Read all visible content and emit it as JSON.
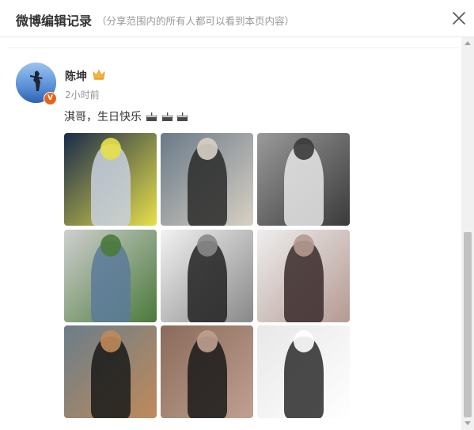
{
  "dialog": {
    "title": "微博编辑记录",
    "subtitle": "（分享范围内的所有人都可以看到本页内容）",
    "close_icon": "close-icon"
  },
  "post": {
    "username": "陈坤",
    "badge_icon": "crown-icon",
    "verified_icon": "verified-v-icon",
    "time": "2小时前",
    "text": "淇哥，生日快乐",
    "emoji": [
      "cake-icon",
      "cake-icon",
      "cake-icon"
    ]
  },
  "photos": [
    {
      "icon": "photo-1",
      "palette": [
        "#1a2a4a",
        "#c8d0e0",
        "#e6e04a"
      ]
    },
    {
      "icon": "photo-2",
      "palette": [
        "#6a7a88",
        "#2a2a2a",
        "#d8d0c4"
      ]
    },
    {
      "icon": "photo-3",
      "palette": [
        "#9a9a9a",
        "#e6e6e6",
        "#3a3a3a"
      ]
    },
    {
      "icon": "photo-4",
      "palette": [
        "#cfcfcf",
        "#5a7a9a",
        "#4a7a3a"
      ]
    },
    {
      "icon": "photo-5",
      "palette": [
        "#f2f2f2",
        "#222222",
        "#888888"
      ]
    },
    {
      "icon": "photo-6",
      "palette": [
        "#eeeeee",
        "#3a2a2a",
        "#b49a92"
      ]
    },
    {
      "icon": "photo-7",
      "palette": [
        "#6a7e8a",
        "#1a1a1a",
        "#c08a5a"
      ]
    },
    {
      "icon": "photo-8",
      "palette": [
        "#8a6a5a",
        "#1a1a1a",
        "#c0a090"
      ]
    },
    {
      "icon": "photo-9",
      "palette": [
        "#e8e8e8",
        "#2a2a2a",
        "#ffffff"
      ]
    }
  ],
  "colors": {
    "title": "#333333",
    "subtitle": "#999999",
    "time": "#939393",
    "verified": "#e8641b"
  }
}
